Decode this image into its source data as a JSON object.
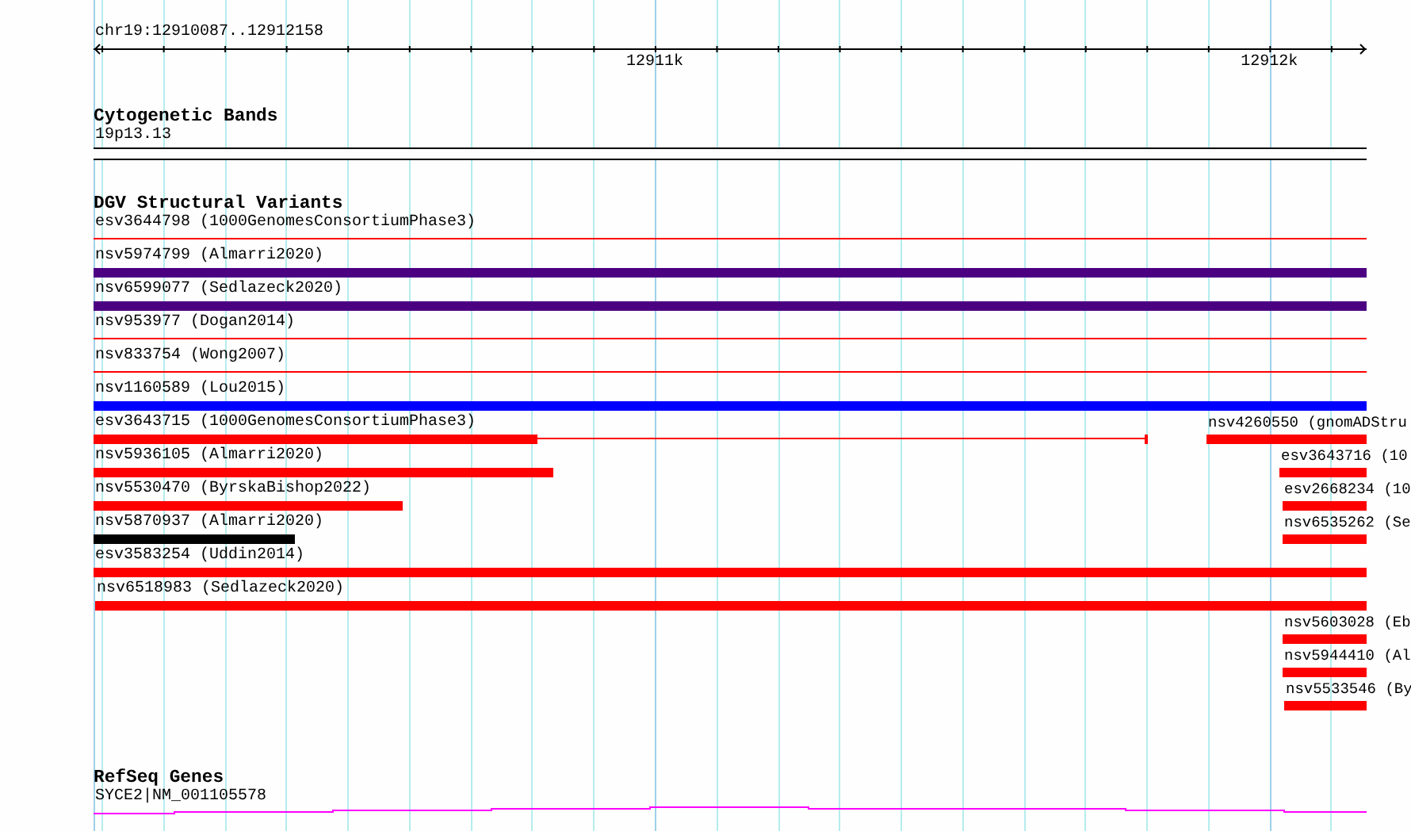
{
  "ruler": {
    "location": "chr19:12910087..12912158",
    "ticks": [
      "12911k",
      "12912k"
    ]
  },
  "tracks": [
    {
      "kind": "cytoband",
      "title": "Cytogenetic Bands",
      "features": [
        {
          "label": "19p13.13"
        }
      ]
    },
    {
      "kind": "variants",
      "title": "DGV Structural Variants",
      "features": [
        {
          "label": "esv3644798 (1000GenomesConsortiumPhase3)",
          "kind": "line",
          "color": "#ff0000"
        },
        {
          "label": "nsv5974799 (Almarri2020)",
          "kind": "bar",
          "color": "#4b0082"
        },
        {
          "label": "nsv6599077 (Sedlazeck2020)",
          "kind": "bar",
          "color": "#4b0082"
        },
        {
          "label": "nsv953977 (Dogan2014)",
          "kind": "line",
          "color": "#ff0000"
        },
        {
          "label": "nsv833754 (Wong2007)",
          "kind": "line",
          "color": "#ff0000"
        },
        {
          "label": "nsv1160589 (Lou2015)",
          "kind": "bar",
          "color": "#0000ff"
        },
        {
          "label": "esv3643715 (1000GenomesConsortiumPhase3)",
          "kind": "gapped",
          "color": "#ff0000"
        },
        {
          "label": "nsv4260550 (gnomADStru",
          "kind": "bar",
          "color": "#ff0000"
        },
        {
          "label": "nsv5936105 (Almarri2020)",
          "kind": "bar",
          "color": "#ff0000"
        },
        {
          "label": "esv3643716 (10",
          "kind": "bar",
          "color": "#ff0000"
        },
        {
          "label": "nsv5530470 (ByrskaBishop2022)",
          "kind": "bar",
          "color": "#ff0000"
        },
        {
          "label": "esv2668234 (10",
          "kind": "bar",
          "color": "#ff0000"
        },
        {
          "label": "nsv5870937 (Almarri2020)",
          "kind": "bar",
          "color": "#000000"
        },
        {
          "label": "nsv6535262 (Se",
          "kind": "bar",
          "color": "#ff0000"
        },
        {
          "label": "esv3583254 (Uddin2014)",
          "kind": "bar",
          "color": "#ff0000"
        },
        {
          "label": "nsv6518983 (Sedlazeck2020)",
          "kind": "bar",
          "color": "#ff0000"
        },
        {
          "label": "nsv5603028 (Eb",
          "kind": "bar",
          "color": "#ff0000"
        },
        {
          "label": "nsv5944410 (Al",
          "kind": "bar",
          "color": "#ff0000"
        },
        {
          "label": "nsv5533546 (By",
          "kind": "bar",
          "color": "#ff0000"
        }
      ]
    },
    {
      "kind": "genes",
      "title": "RefSeq Genes",
      "features": [
        {
          "label": "SYCE2|NM_001105578"
        }
      ]
    }
  ]
}
